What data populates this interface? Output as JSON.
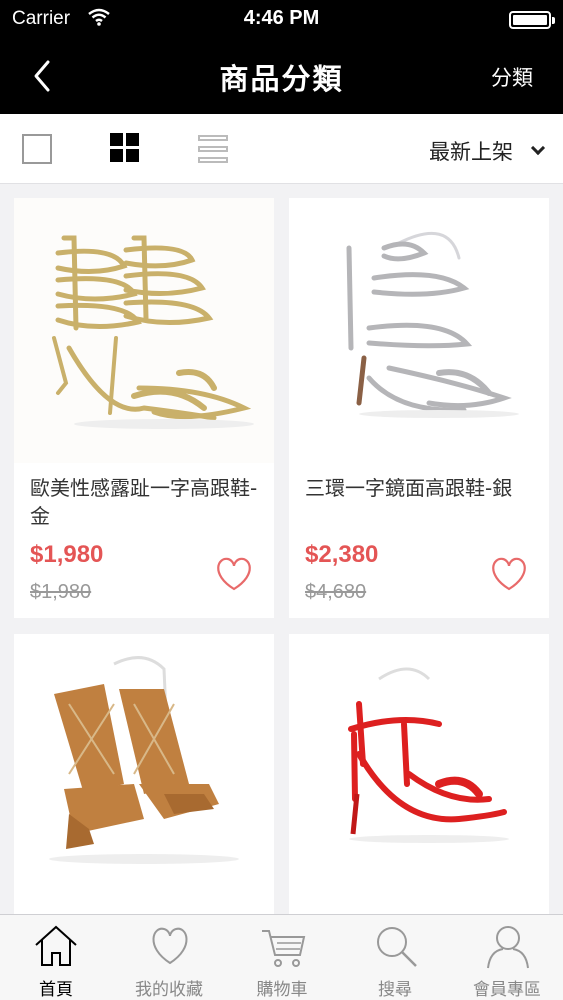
{
  "status": {
    "carrier": "Carrier",
    "time": "4:46 PM"
  },
  "nav": {
    "title": "商品分類",
    "right_label": "分類"
  },
  "toolbar": {
    "sort_label": "最新上架"
  },
  "products": [
    {
      "name": "歐美性感露趾一字高跟鞋-金",
      "price": "$1,980",
      "original_price": "$1,980"
    },
    {
      "name": "三環一字鏡面高跟鞋-銀",
      "price": "$2,380",
      "original_price": "$4,680"
    },
    {
      "name": "",
      "price": "",
      "original_price": ""
    },
    {
      "name": "",
      "price": "",
      "original_price": ""
    }
  ],
  "tabs": [
    {
      "label": "首頁",
      "icon": "home-icon"
    },
    {
      "label": "我的收藏",
      "icon": "heart-icon"
    },
    {
      "label": "購物車",
      "icon": "cart-icon"
    },
    {
      "label": "搜尋",
      "icon": "search-icon"
    },
    {
      "label": "會員專區",
      "icon": "user-icon"
    }
  ],
  "colors": {
    "price": "#e45555",
    "heart": "#e86a6a",
    "nav_bg": "#000000"
  }
}
